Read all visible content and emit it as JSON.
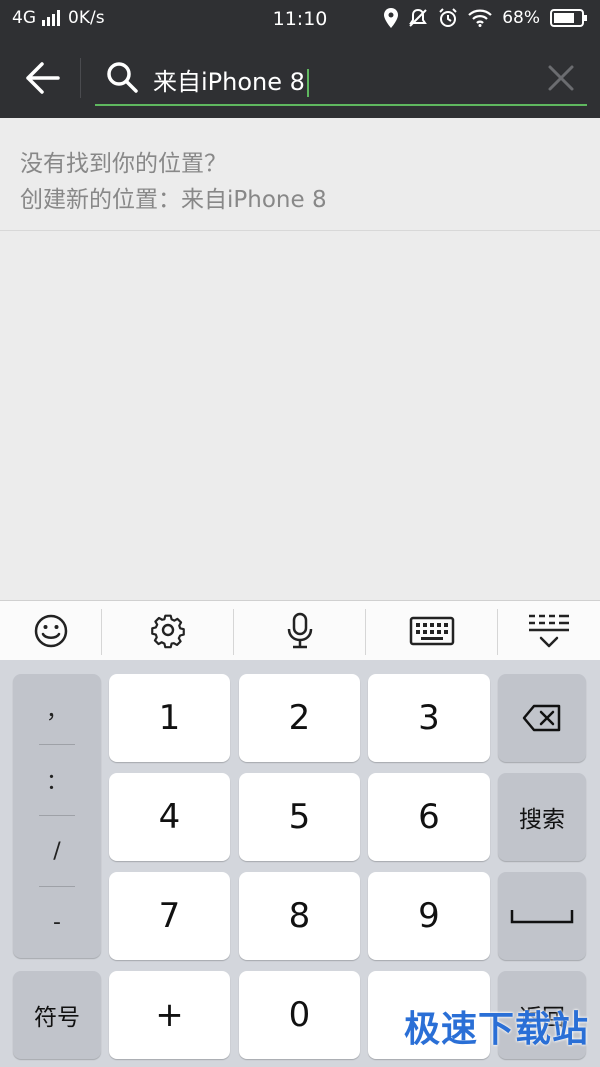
{
  "status_bar": {
    "network": "4G",
    "speed": "0K/s",
    "time": "11:10",
    "battery": "68%"
  },
  "search": {
    "query": "来自iPhone 8"
  },
  "suggestion": {
    "line1": "没有找到你的位置？",
    "line2": "创建新的位置：来自iPhone 8"
  },
  "keyboard": {
    "punct": [
      "，",
      "：",
      "/",
      "-"
    ],
    "digits": [
      "1",
      "2",
      "3",
      "4",
      "5",
      "6",
      "7",
      "8",
      "9",
      "0"
    ],
    "plus": "+",
    "symbols_label": "符号",
    "search_label": "搜索",
    "return_label": "返回"
  },
  "watermark": "极速下载站",
  "colors": {
    "bar_bg": "#2f3033",
    "accent": "#5fb85f",
    "watermark": "#2a6fd6"
  }
}
